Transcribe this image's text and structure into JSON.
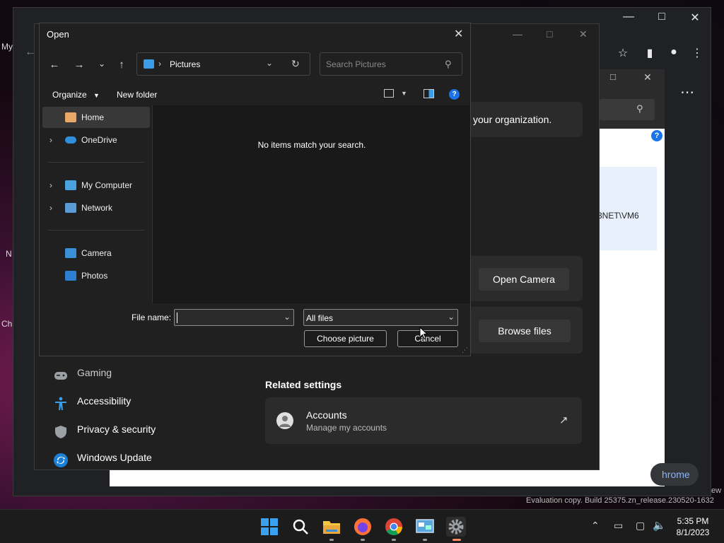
{
  "desktop": {
    "left_edge_texts": [
      "My",
      "N",
      "Ch"
    ],
    "watermark": "Evaluation copy. Build 25375.zn_release.230520-1632",
    "watermark_tail": "ew"
  },
  "chrome": {
    "toolbar_icons": [
      "minimize-icon",
      "maximize-icon",
      "close-icon",
      "star-icon",
      "profile-icon",
      "menu-dots-icon",
      "apps-grid-icon"
    ]
  },
  "webpage": {
    "search_hint": "your organization.",
    "account_text": "3NET\\VM6",
    "bottom_pill": "hrome"
  },
  "settings": {
    "nav": [
      {
        "label": "Gaming",
        "icon": "gamepad-icon"
      },
      {
        "label": "Accessibility",
        "icon": "accessibility-icon"
      },
      {
        "label": "Privacy & security",
        "icon": "shield-icon"
      },
      {
        "label": "Windows Update",
        "icon": "update-icon"
      }
    ],
    "open_camera_label": "Open Camera",
    "browse_files_label": "Browse files",
    "related_heading": "Related settings",
    "accounts_title": "Accounts",
    "accounts_subtitle": "Manage my accounts"
  },
  "dialog": {
    "title": "Open",
    "address_folder": "Pictures",
    "search_placeholder": "Search Pictures",
    "organize_label": "Organize",
    "new_folder_label": "New folder",
    "nav_items": [
      {
        "label": "Home",
        "icon": "home-icon",
        "expandable": false,
        "selected": true
      },
      {
        "label": "OneDrive",
        "icon": "onedrive-icon",
        "expandable": true
      },
      {
        "label": "My Computer",
        "icon": "computer-icon",
        "expandable": true
      },
      {
        "label": "Network",
        "icon": "network-icon",
        "expandable": true
      },
      {
        "label": "Camera",
        "icon": "camera-folder-icon",
        "expandable": false
      },
      {
        "label": "Photos",
        "icon": "photos-folder-icon",
        "expandable": false
      }
    ],
    "empty_message": "No items match your search.",
    "file_name_label": "File name:",
    "file_name_value": "",
    "file_type_value": "All files",
    "choose_label": "Choose picture",
    "cancel_label": "Cancel"
  },
  "taskbar": {
    "apps": [
      "start-icon",
      "search-icon",
      "file-explorer-icon",
      "firefox-icon",
      "chrome-icon",
      "control-panel-icon",
      "settings-icon"
    ],
    "time": "5:35 PM",
    "date": "8/1/2023"
  },
  "colors": {
    "accent_blue": "#1a73e8",
    "settings_bg": "#202020",
    "dialog_bg": "#191919"
  }
}
